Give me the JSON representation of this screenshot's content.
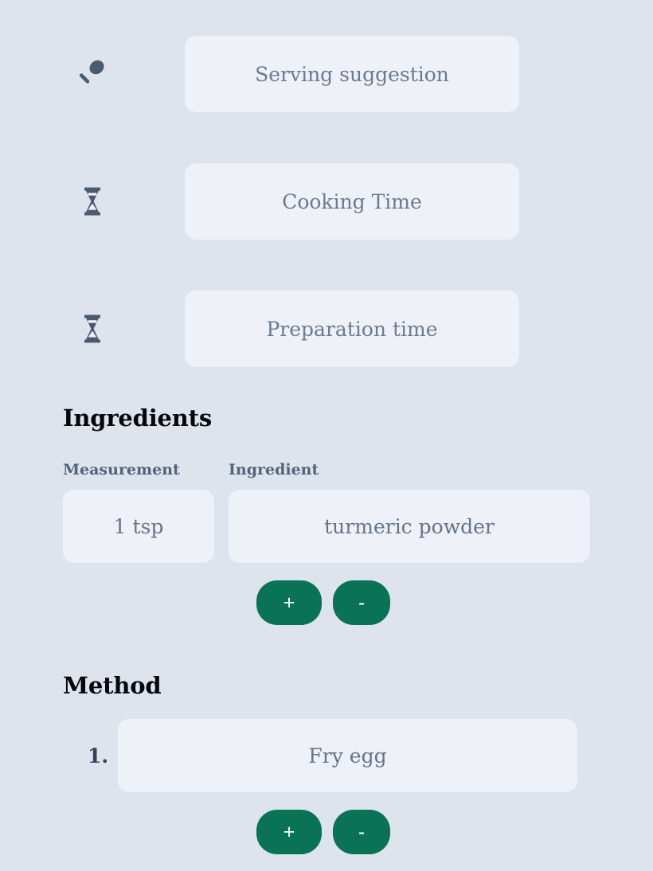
{
  "theme": {
    "background": "#dee4ed",
    "field_fill": "#eef1f7",
    "field_text": "#6b7a90",
    "heading_text": "#05070a",
    "label_text": "#53637a",
    "accent_green": "#0b7355",
    "button_text": "#ffffff"
  },
  "meta_rows": [
    {
      "icon": "spoon-icon",
      "placeholder": "Serving suggestion",
      "value": ""
    },
    {
      "icon": "hourglass-icon",
      "placeholder": "Cooking Time",
      "value": ""
    },
    {
      "icon": "hourglass-icon",
      "placeholder": "Preparation time",
      "value": ""
    }
  ],
  "ingredients": {
    "heading": "Ingredients",
    "columns": {
      "measurement": "Measurement",
      "ingredient": "Ingredient"
    },
    "rows": [
      {
        "measurement": "1 tsp",
        "ingredient": "turmeric powder"
      }
    ],
    "add_label": "+",
    "remove_label": "-"
  },
  "method": {
    "heading": "Method",
    "steps": [
      {
        "number": "1.",
        "text": "Fry egg"
      }
    ],
    "add_label": "+",
    "remove_label": "-"
  }
}
